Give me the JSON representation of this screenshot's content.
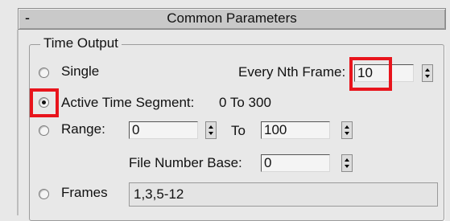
{
  "rollout": {
    "collapse_symbol": "-",
    "title": "Common Parameters"
  },
  "time_output": {
    "group_label": "Time Output",
    "single": {
      "label": "Single",
      "selected": false
    },
    "every_nth": {
      "label": "Every Nth Frame:",
      "value": "10"
    },
    "active_segment": {
      "label": "Active Time Segment:",
      "value": "0 To 300",
      "selected": true
    },
    "range": {
      "label": "Range:",
      "start": "0",
      "to_label": "To",
      "end": "100",
      "selected": false
    },
    "file_number_base": {
      "label": "File Number Base:",
      "value": "0"
    },
    "frames": {
      "label": "Frames",
      "value": "1,3,5-12",
      "selected": false
    }
  },
  "highlight_color": "#e8141c",
  "icons": [
    "radio-button-icon",
    "spinner-up-arrow-icon",
    "spinner-down-arrow-icon"
  ]
}
